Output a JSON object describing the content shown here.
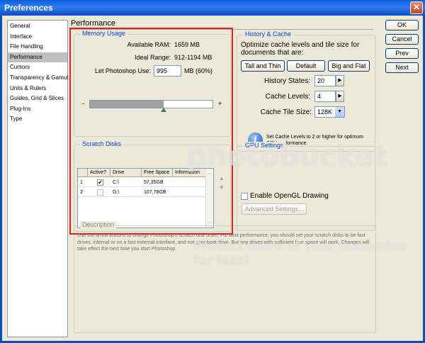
{
  "window": {
    "title": "Preferences",
    "close": "✕"
  },
  "nav": {
    "items": [
      {
        "label": "General",
        "selected": false
      },
      {
        "label": "Interface",
        "selected": false
      },
      {
        "label": "File Handling",
        "selected": false
      },
      {
        "label": "Performance",
        "selected": true
      },
      {
        "label": "Cursors",
        "selected": false
      },
      {
        "label": "Transparency & Gamut",
        "selected": false
      },
      {
        "label": "Units & Rulers",
        "selected": false
      },
      {
        "label": "Guides, Grid & Slices",
        "selected": false
      },
      {
        "label": "Plug-Ins",
        "selected": false
      },
      {
        "label": "Type",
        "selected": false
      }
    ]
  },
  "page": {
    "title": "Performance"
  },
  "memory": {
    "legend": "Memory Usage",
    "available_label": "Available RAM:",
    "available_value": "1659 MB",
    "ideal_label": "Ideal Range:",
    "ideal_value": "912-1194 MB",
    "let_label": "Let Photoshop Use:",
    "let_value": "995",
    "let_suffix": "MB (60%)",
    "slider_fraction": 0.6,
    "minus": "-",
    "plus": "+"
  },
  "history": {
    "legend": "History & Cache",
    "description": "Optimize cache levels and tile size for documents that are:",
    "buttons": [
      "Tall and Thin",
      "Default",
      "Big and Flat"
    ],
    "states_label": "History States:",
    "states_value": "20",
    "levels_label": "Cache Levels:",
    "levels_value": "4",
    "tile_label": "Cache Tile Size:",
    "tile_value": "128K",
    "note": "Set Cache Levels to 2 or higher for optimum GPU performance.",
    "info_icon": "i"
  },
  "scratch": {
    "legend": "Scratch Disks",
    "columns": [
      "Active?",
      "Drive",
      "Free Space",
      "Information"
    ],
    "rows": [
      {
        "num": "1",
        "active": true,
        "check": "✔",
        "drive": "C:\\",
        "free": "57,35GB",
        "info": ""
      },
      {
        "num": "2",
        "active": false,
        "check": "",
        "drive": "G:\\",
        "free": "107,78GB",
        "info": ""
      }
    ],
    "up": "▲",
    "down": "▼"
  },
  "gpu": {
    "legend": "GPU Settings",
    "opengl_label": "Enable OpenGL Drawing",
    "advanced_label": "Advanced Settings..."
  },
  "description": {
    "legend": "Description",
    "text": "Use the arrow buttons to change Photoshop's scratch disk order. For best performance, you should set your scratch disks to be fast drives, internal or on a fast external interface, and not your boot drive. But any drives with sufficient free space will work. Changes will take effect the next time you start Photoshop."
  },
  "actions": {
    "ok": "OK",
    "cancel": "Cancel",
    "prev": "Prev",
    "next": "Next"
  },
  "watermark": {
    "brand": "photobucket",
    "tagline": "Protect more of your memories for less!"
  }
}
